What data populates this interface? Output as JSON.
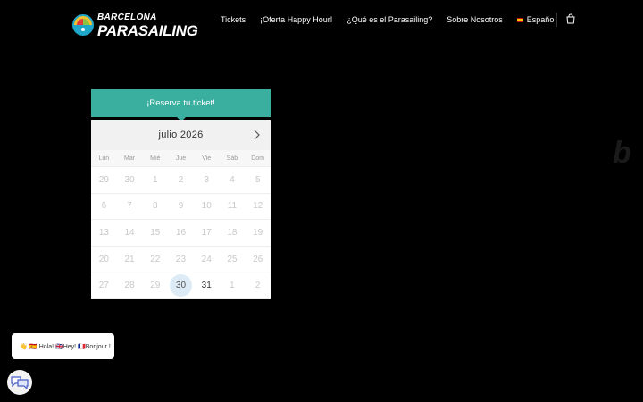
{
  "logo": {
    "line1": "BARCELONA",
    "line2": "PARASAILING"
  },
  "nav": {
    "items": [
      {
        "label": "Tickets"
      },
      {
        "label": "¡Oferta Happy Hour!"
      },
      {
        "label": "¿Qué es el Parasailing?"
      },
      {
        "label": "Sobre Nosotros"
      }
    ],
    "language": "Español",
    "cart_icon": "shopping-bag-icon"
  },
  "widget": {
    "header": "¡Reserva tu ticket!",
    "calendar": {
      "title": "julio 2026",
      "weekdays": [
        "Lun",
        "Mar",
        "Mié",
        "Jue",
        "Vie",
        "Sáb",
        "Dom"
      ],
      "rows": [
        [
          "29",
          "30",
          "1",
          "2",
          "3",
          "4",
          "5"
        ],
        [
          "6",
          "7",
          "8",
          "9",
          "10",
          "11",
          "12"
        ],
        [
          "13",
          "14",
          "15",
          "16",
          "17",
          "18",
          "19"
        ],
        [
          "20",
          "21",
          "22",
          "23",
          "24",
          "25",
          "26"
        ],
        [
          "27",
          "28",
          "29",
          "30",
          "31",
          "1",
          "2"
        ]
      ],
      "today": "30",
      "available": [
        "31"
      ]
    }
  },
  "chat": {
    "greeting": "👋 🇪🇸¡Hola! 🇬🇧Hey! 🇫🇷Bonjour !",
    "launcher_icon": "chat-bubbles-icon"
  },
  "background": {
    "text": "b"
  }
}
